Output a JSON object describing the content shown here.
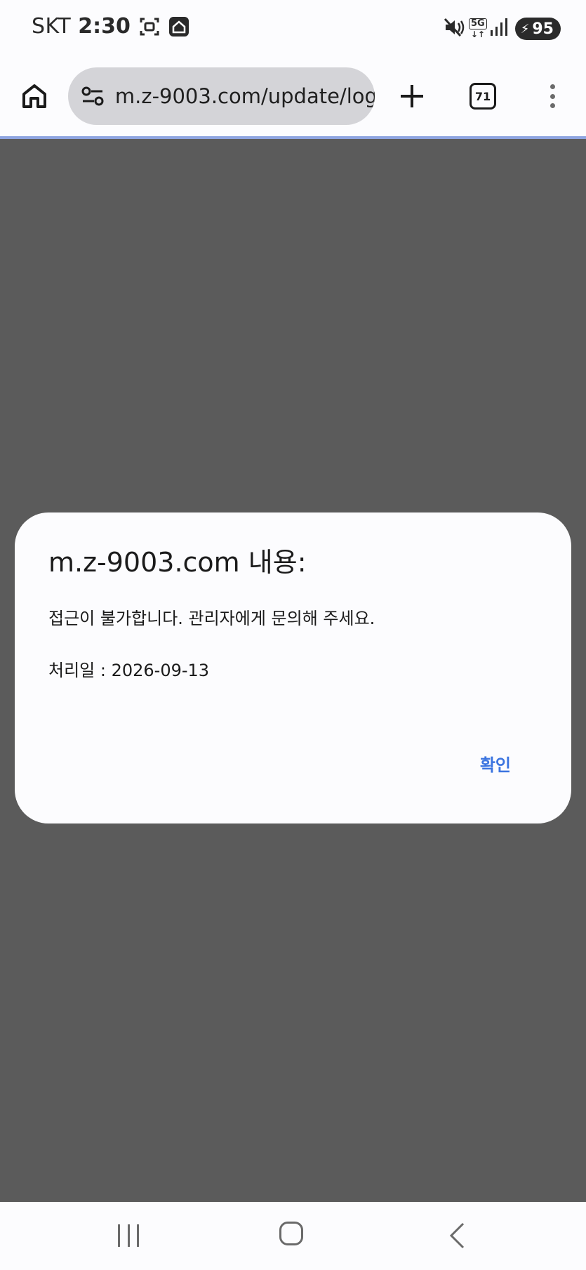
{
  "status_bar": {
    "carrier": "SKT",
    "time": "2:30",
    "network": "5G",
    "battery_level": "95",
    "icons": [
      "screenshot-icon",
      "home-status-icon",
      "mute-icon",
      "network-5g-icon",
      "signal-icon",
      "battery-charging-icon"
    ]
  },
  "browser": {
    "url": "m.z-9003.com/update/logi",
    "tab_count": "71",
    "icons": [
      "home-icon",
      "site-settings-icon",
      "new-tab-icon",
      "tab-switcher-icon",
      "more-menu-icon"
    ]
  },
  "dialog": {
    "title": "m.z-9003.com 내용:",
    "message_line1": "접근이 불가합니다. 관리자에게 문의해 주세요.",
    "message_line2": "처리일 : 2026-09-13",
    "confirm_label": "확인",
    "accent_color": "#3b74e0"
  },
  "nav_bar": {
    "icons": [
      "recent-apps-icon",
      "home-nav-icon",
      "back-icon"
    ]
  }
}
